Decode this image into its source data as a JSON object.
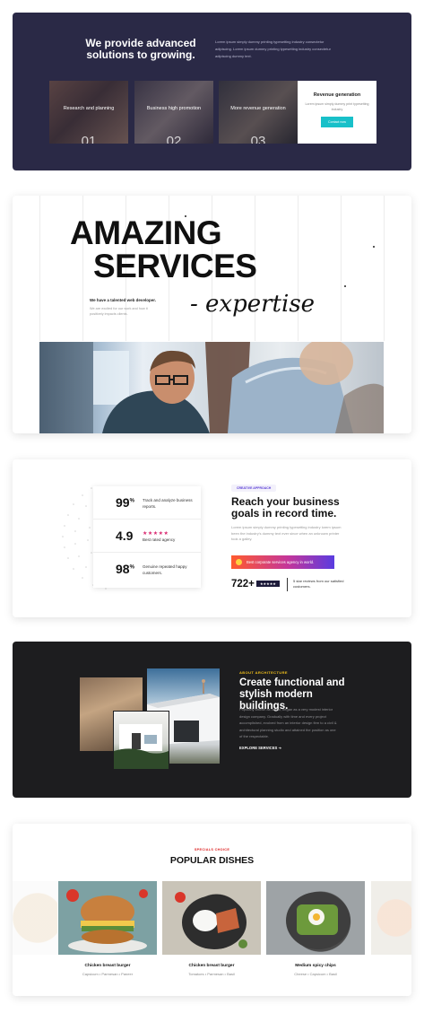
{
  "solutions": {
    "heading": "We provide advanced solutions to growing.",
    "description": "Lorem ipsum simply dummy printing typesetting industry consectetur adipiscing. Lorem ipsum dummy printing typesetting industry consectetur adipiscing dummy text.",
    "tiles": [
      {
        "label": "Research and planning",
        "number": "01"
      },
      {
        "label": "Business high promotion",
        "number": "02"
      },
      {
        "label": "More revenue generation",
        "number": "03"
      }
    ],
    "revenue_card": {
      "title": "Revenue generation",
      "text": "Lorem ipsum simply dummy print typesetting industry",
      "button": "Contact now"
    }
  },
  "services": {
    "line1": "AMAZING",
    "line2": "SERVICES",
    "script": "- expertise",
    "subheading": "We have a talented web developer.",
    "text": "We are excited for our work and how it positively impacts clients."
  },
  "stats": {
    "items": [
      {
        "value": "99",
        "unit": "%",
        "label": "Track and analyze business reports."
      },
      {
        "value": "4.9",
        "unit": "",
        "label": "Best rated agency",
        "stars": "★★★★★"
      },
      {
        "value": "98",
        "unit": "%",
        "label": "Genuine repeated happy customers."
      }
    ],
    "chip": "CREATIVE APPROACH",
    "heading": "Reach your business goals in record time.",
    "text": "Lorem ipsum simply dummy printing typesetting industry lorem ipsum been the industry's dummy text ever since when an unknown printer took a galley.",
    "banner": "Best corporate services agency in world.",
    "count": "722+",
    "badge": "★★★★★",
    "reviews": "5 star reviews from our satisfied customers."
  },
  "architecture": {
    "tag": "ABOUT ARCHITECTURE",
    "heading": "Create functional and stylish modern buildings.",
    "text": "Popularly known as crafto, began as a very modest interior design company. Gradually with time and every project accomplished, evolved from an interior design firm to a civil & architectural planning studio and attained the position as one of the respectable.",
    "link": "EXPLORE SERVICES ➔"
  },
  "dishes": {
    "tag": "SPECIALS CHOICE",
    "heading": "POPULAR DISHES",
    "items": [
      {
        "name": "Chicken breast burger",
        "ingredients": "Capsicum  •  Parmesan  •  Paneer"
      },
      {
        "name": "Chicken breast burger",
        "ingredients": "Tomatoes  •  Parmesan  •  Basil"
      },
      {
        "name": "Medium spicy chips",
        "ingredients": "Cheese  •  Capsicum  •  Basil"
      }
    ]
  },
  "colors": {
    "navy": "#2a2946",
    "dark": "#1d1d1f",
    "teal_button": "#18c0c9",
    "accent_yellow": "#f4c21c",
    "accent_red": "#dd2222"
  }
}
